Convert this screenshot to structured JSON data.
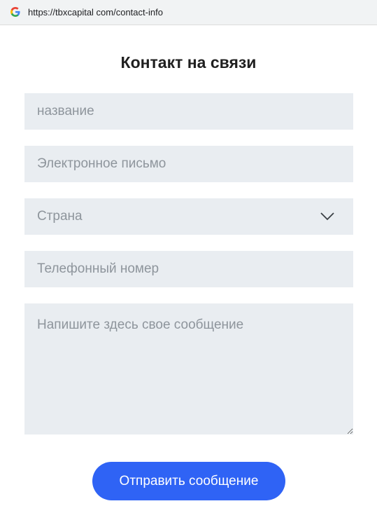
{
  "browser": {
    "url": "https://tbxcapital com/contact-info",
    "favicon_icon": "google-g-icon"
  },
  "page": {
    "title": "Контакт на связи"
  },
  "form": {
    "name_placeholder": "название",
    "email_placeholder": "Электронное письмо",
    "country_selected": "Страна",
    "country_icon": "chevron-down-icon",
    "phone_placeholder": "Телефонный номер",
    "message_placeholder": "Напишите здесь свое сообщение",
    "submit_label": "Отправить сообщение"
  },
  "colors": {
    "field_background": "#e9edf1",
    "placeholder": "#8e959c",
    "button": "#2f63f5",
    "button_text": "#ffffff",
    "title": "#1f1f1f"
  }
}
